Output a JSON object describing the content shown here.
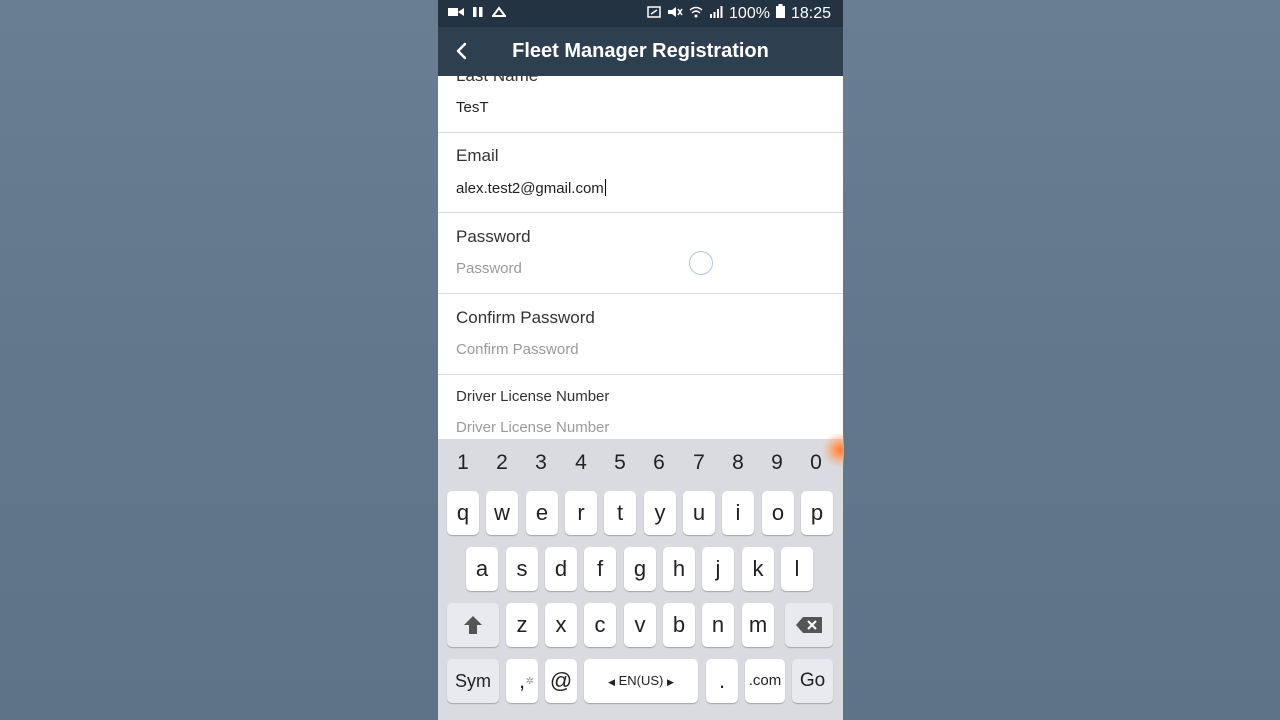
{
  "status_bar": {
    "battery": "100%",
    "time": "18:25",
    "icons": [
      "video-icon",
      "pause-icon",
      "sync-icon",
      "nfc-icon",
      "mute-icon",
      "wifi-icon",
      "signal-icon",
      "battery-icon"
    ]
  },
  "app_bar": {
    "title": "Fleet Manager Registration",
    "back_icon": "chevron-left-icon"
  },
  "form": {
    "last_name": {
      "label": "Last Name",
      "value": "TesT"
    },
    "email": {
      "label": "Email",
      "value": "alex.test2@gmail.com"
    },
    "password": {
      "label": "Password",
      "placeholder": "Password"
    },
    "confirm_password": {
      "label": "Confirm Password",
      "placeholder": "Confirm Password"
    },
    "driver_license": {
      "label": "Driver License Number",
      "placeholder": "Driver License Number"
    }
  },
  "keyboard": {
    "numbers": [
      "1",
      "2",
      "3",
      "4",
      "5",
      "6",
      "7",
      "8",
      "9",
      "0"
    ],
    "row1": [
      "q",
      "w",
      "e",
      "r",
      "t",
      "y",
      "u",
      "i",
      "o",
      "p"
    ],
    "row2": [
      "a",
      "s",
      "d",
      "f",
      "g",
      "h",
      "j",
      "k",
      "l"
    ],
    "row3": [
      "z",
      "x",
      "c",
      "v",
      "b",
      "n",
      "m"
    ],
    "sym": "Sym",
    "comma": ",",
    "at": "@",
    "language": "EN(US)",
    "period": ".",
    "dotcom": ".com",
    "go": "Go"
  },
  "colors": {
    "status_bar": "#243341",
    "app_bar": "#2e3f4f",
    "background": "#64788e",
    "keyboard": "#d9dbe0"
  }
}
